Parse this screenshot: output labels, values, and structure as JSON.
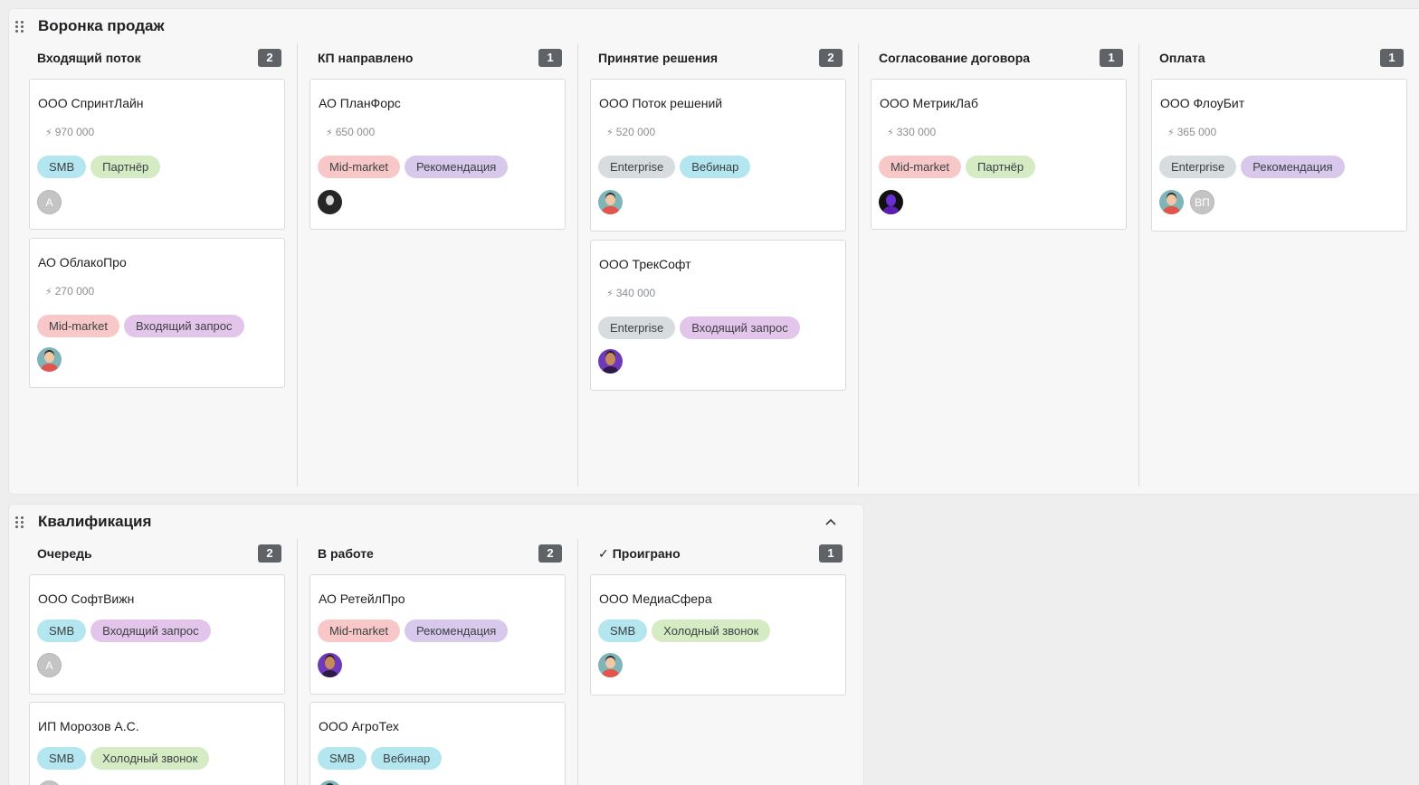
{
  "colors": {
    "tag_smb": "#b3e6ef",
    "tag_partner": "#d4ebc4",
    "tag_midmarket": "#f8c8c8",
    "tag_inbound": "#e3c4ea",
    "tag_referral": "#d7c8ec",
    "tag_enterprise": "#d7dcdf",
    "tag_webinar": "#b3e6ef",
    "tag_cold_call": "#d4ebc4",
    "count_badge": "#5f6368"
  },
  "boards": [
    {
      "title": "Воронка продаж",
      "collapse_icon": "chevron-up-icon",
      "columns": [
        {
          "title": "Входящий поток",
          "count": "2",
          "cards": [
            {
              "name": "ООО СпринтЛайн",
              "amount": "970 000",
              "tags": [
                "SMB",
                "Партнёр"
              ],
              "avatars": [
                "A"
              ]
            },
            {
              "name": "АО ОблакоПро",
              "amount": "270 000",
              "tags": [
                "Mid-market",
                "Входящий запрос"
              ],
              "avatars": [
                ""
              ]
            }
          ]
        },
        {
          "title": "КП направлено",
          "count": "1",
          "cards": [
            {
              "name": "АО ПланФорс",
              "amount": "650 000",
              "tags": [
                "Mid-market",
                "Рекомендация"
              ],
              "avatars": [
                ""
              ]
            }
          ]
        },
        {
          "title": "Принятие решения",
          "count": "2",
          "cards": [
            {
              "name": "ООО Поток решений",
              "amount": "520 000",
              "tags": [
                "Enterprise",
                "Вебинар"
              ],
              "avatars": [
                ""
              ]
            },
            {
              "name": "ООО ТрекСофт",
              "amount": "340 000",
              "tags": [
                "Enterprise",
                "Входящий запрос"
              ],
              "avatars": [
                ""
              ]
            }
          ]
        },
        {
          "title": "Согласование договора",
          "count": "1",
          "cards": [
            {
              "name": "ООО МетрикЛаб",
              "amount": "330 000",
              "tags": [
                "Mid-market",
                "Партнёр"
              ],
              "avatars": [
                ""
              ]
            }
          ]
        },
        {
          "title": "Оплата",
          "count": "1",
          "cards": [
            {
              "name": "ООО ФлоуБит",
              "amount": "365 000",
              "tags": [
                "Enterprise",
                "Рекомендация"
              ],
              "avatars": [
                "",
                "ВП"
              ]
            }
          ]
        }
      ]
    },
    {
      "title": "Квалификация",
      "collapse_icon": "chevron-up-icon",
      "collapse_glyph": "⌃",
      "columns": [
        {
          "title": "Очередь",
          "count": "2",
          "cards": [
            {
              "name": "ООО СофтВижн",
              "tags": [
                "SMB",
                "Входящий запрос"
              ],
              "avatars": [
                "A"
              ]
            },
            {
              "name": "ИП Морозов А.С.",
              "tags": [
                "SMB",
                "Холодный звонок"
              ],
              "avatars": [
                ""
              ]
            }
          ]
        },
        {
          "title": "В работе",
          "count": "2",
          "cards": [
            {
              "name": "АО РетейлПро",
              "tags": [
                "Mid-market",
                "Рекомендация"
              ],
              "avatars": [
                ""
              ]
            },
            {
              "name": "ООО АгроТех",
              "tags": [
                "SMB",
                "Вебинар"
              ],
              "avatars": [
                ""
              ]
            }
          ]
        },
        {
          "title": "Проиграно",
          "check_glyph": "✓",
          "count": "1",
          "cards": [
            {
              "name": "ООО МедиаСфера",
              "tags": [
                "SMB",
                "Холодный звонок"
              ],
              "avatars": [
                ""
              ]
            }
          ]
        }
      ]
    }
  ],
  "amount_icon": "bolt-icon",
  "amount_glyph": "⚡"
}
